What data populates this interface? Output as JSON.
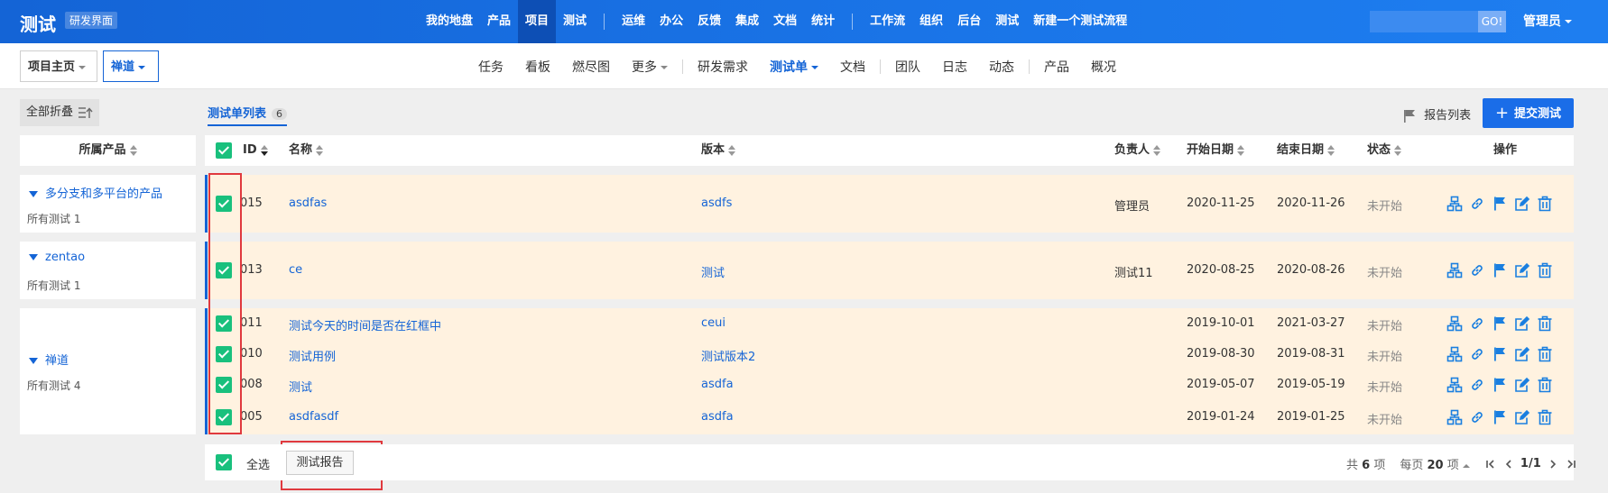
{
  "app": {
    "title": "测试",
    "tag": "研发界面"
  },
  "main_nav": {
    "group1": [
      "我的地盘",
      "产品",
      "项目",
      "测试"
    ],
    "active": "项目",
    "group2": [
      "运维",
      "办公",
      "反馈",
      "集成",
      "文档",
      "统计"
    ],
    "group3": [
      "工作流",
      "组织",
      "后台",
      "测试",
      "新建一个测试流程"
    ]
  },
  "search": {
    "go_label": "GO!"
  },
  "user": {
    "name": "管理员"
  },
  "breadcrumb": {
    "home": "项目主页",
    "current": "禅道"
  },
  "sub_nav": {
    "group1": [
      "任务",
      "看板",
      "燃尽图",
      "更多"
    ],
    "group2": [
      "研发需求",
      "测试单",
      "文档"
    ],
    "group3": [
      "团队",
      "日志",
      "动态"
    ],
    "group4": [
      "产品",
      "概况"
    ],
    "active": "测试单"
  },
  "left_pane": {
    "collapse_label": "全部折叠",
    "header": "所属产品",
    "products": [
      {
        "name": "多分支和多平台的产品",
        "count": "所有测试 1"
      },
      {
        "name": "zentao",
        "count": "所有测试 1"
      },
      {
        "name": "禅道",
        "count": "所有测试 4"
      }
    ]
  },
  "list": {
    "tab_label": "测试单列表",
    "tab_count": "6"
  },
  "toolbar": {
    "report_list": "报告列表",
    "submit": "提交测试"
  },
  "table": {
    "headers": {
      "id": "ID",
      "name": "名称",
      "build": "版本",
      "owner": "负责人",
      "begin": "开始日期",
      "end": "结束日期",
      "status": "状态",
      "actions": "操作"
    },
    "rows": [
      {
        "id": "015",
        "name": "asdfas",
        "build": "asdfs",
        "owner": "管理员",
        "begin": "2020-11-25",
        "end": "2020-11-26",
        "status": "未开始",
        "checked": true
      },
      {
        "id": "013",
        "name": "ce",
        "build": "测试",
        "owner": "测试11",
        "begin": "2020-08-25",
        "end": "2020-08-26",
        "status": "未开始",
        "checked": true
      },
      {
        "id": "011",
        "name": "测试今天的时间是否在红框中",
        "build": "ceui",
        "owner": "",
        "begin": "2019-10-01",
        "end": "2021-03-27",
        "status": "未开始",
        "checked": true
      },
      {
        "id": "010",
        "name": "测试用例",
        "build": "测试版本2",
        "owner": "",
        "begin": "2019-08-30",
        "end": "2019-08-31",
        "status": "未开始",
        "checked": true
      },
      {
        "id": "008",
        "name": "测试",
        "build": "asdfa",
        "owner": "",
        "begin": "2019-05-07",
        "end": "2019-05-19",
        "status": "未开始",
        "checked": true
      },
      {
        "id": "005",
        "name": "asdfasdf",
        "build": "asdfa",
        "owner": "",
        "begin": "2019-01-24",
        "end": "2019-01-25",
        "status": "未开始",
        "checked": true
      }
    ]
  },
  "footer": {
    "select_all": "全选",
    "report_button": "测试报告",
    "pager": {
      "total_prefix": "共",
      "total": "6",
      "total_suffix": "项",
      "per_page_prefix": "每页",
      "per_page": "20",
      "per_page_suffix": "项",
      "page": "1/1"
    }
  },
  "colors": {
    "brand": "#1464d6",
    "row_bg": "#fff2e0",
    "checkbox": "#19c07d",
    "highlight": "#e0393e",
    "action_icon": "#1a7fe0"
  },
  "action_icons": [
    "group-icon",
    "link-icon",
    "flag-icon",
    "edit-icon",
    "delete-icon"
  ]
}
